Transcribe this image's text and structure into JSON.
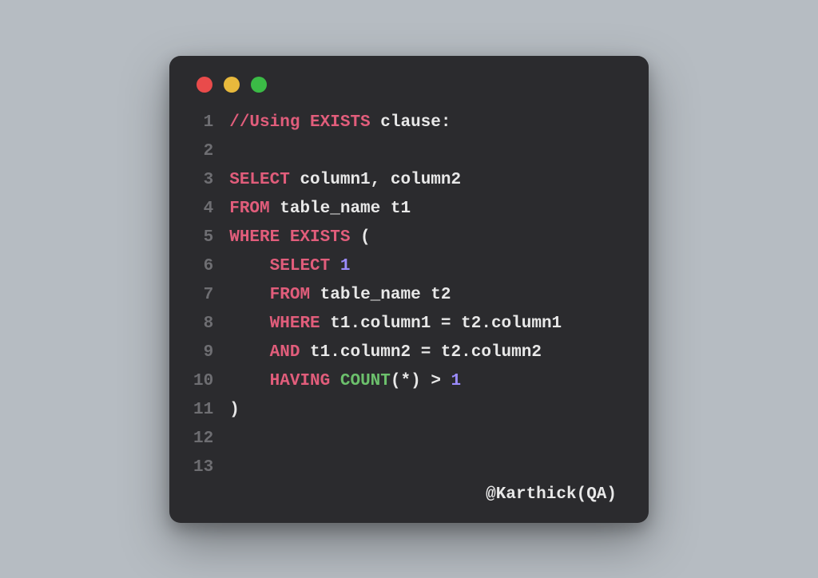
{
  "window": {
    "traffic_lights": [
      "red",
      "yellow",
      "green"
    ]
  },
  "code": {
    "lines": [
      {
        "num": "1",
        "tokens": [
          {
            "t": "//Using EXISTS",
            "c": "comment"
          },
          {
            "t": " clause:",
            "c": "plain"
          }
        ]
      },
      {
        "num": "2",
        "tokens": []
      },
      {
        "num": "3",
        "tokens": [
          {
            "t": "SELECT",
            "c": "kw"
          },
          {
            "t": " column1",
            "c": "plain"
          },
          {
            "t": ",",
            "c": "punct"
          },
          {
            "t": " column2",
            "c": "plain"
          }
        ]
      },
      {
        "num": "4",
        "tokens": [
          {
            "t": "FROM",
            "c": "kw"
          },
          {
            "t": " table_name t1",
            "c": "plain"
          }
        ]
      },
      {
        "num": "5",
        "tokens": [
          {
            "t": "WHERE EXISTS",
            "c": "kw"
          },
          {
            "t": " (",
            "c": "punct"
          }
        ]
      },
      {
        "num": "6",
        "tokens": [
          {
            "t": "    ",
            "c": "plain"
          },
          {
            "t": "SELECT",
            "c": "kw"
          },
          {
            "t": " ",
            "c": "plain"
          },
          {
            "t": "1",
            "c": "num"
          }
        ]
      },
      {
        "num": "7",
        "tokens": [
          {
            "t": "    ",
            "c": "plain"
          },
          {
            "t": "FROM",
            "c": "kw"
          },
          {
            "t": " table_name t2",
            "c": "plain"
          }
        ]
      },
      {
        "num": "8",
        "tokens": [
          {
            "t": "    ",
            "c": "plain"
          },
          {
            "t": "WHERE",
            "c": "kw"
          },
          {
            "t": " t1",
            "c": "plain"
          },
          {
            "t": ".",
            "c": "punct"
          },
          {
            "t": "column1 ",
            "c": "plain"
          },
          {
            "t": "=",
            "c": "op"
          },
          {
            "t": " t2",
            "c": "plain"
          },
          {
            "t": ".",
            "c": "punct"
          },
          {
            "t": "column1",
            "c": "plain"
          }
        ]
      },
      {
        "num": "9",
        "tokens": [
          {
            "t": "    ",
            "c": "plain"
          },
          {
            "t": "AND",
            "c": "kw"
          },
          {
            "t": " t1",
            "c": "plain"
          },
          {
            "t": ".",
            "c": "punct"
          },
          {
            "t": "column2 ",
            "c": "plain"
          },
          {
            "t": "=",
            "c": "op"
          },
          {
            "t": " t2",
            "c": "plain"
          },
          {
            "t": ".",
            "c": "punct"
          },
          {
            "t": "column2",
            "c": "plain"
          }
        ]
      },
      {
        "num": "10",
        "tokens": [
          {
            "t": "    ",
            "c": "plain"
          },
          {
            "t": "HAVING",
            "c": "kw"
          },
          {
            "t": " ",
            "c": "plain"
          },
          {
            "t": "COUNT",
            "c": "func"
          },
          {
            "t": "(",
            "c": "punct"
          },
          {
            "t": "*",
            "c": "op"
          },
          {
            "t": ")",
            "c": "punct"
          },
          {
            "t": " ",
            "c": "plain"
          },
          {
            "t": ">",
            "c": "op"
          },
          {
            "t": " ",
            "c": "plain"
          },
          {
            "t": "1",
            "c": "num"
          }
        ]
      },
      {
        "num": "11",
        "tokens": [
          {
            "t": ")",
            "c": "punct"
          }
        ]
      },
      {
        "num": "12",
        "tokens": []
      },
      {
        "num": "13",
        "tokens": []
      }
    ]
  },
  "footer": {
    "credit": "@Karthick(QA)"
  },
  "colors": {
    "bg_page": "#b6bcc2",
    "bg_window": "#2b2b2e",
    "gutter": "#6e6e72",
    "plain": "#e8e8e8",
    "keyword": "#e15d7b",
    "comment": "#e15d7b",
    "func": "#6cc06c",
    "num": "#9b8cff",
    "red": "#e94b4b",
    "yellow": "#e8b93c",
    "green": "#3bbb46"
  }
}
